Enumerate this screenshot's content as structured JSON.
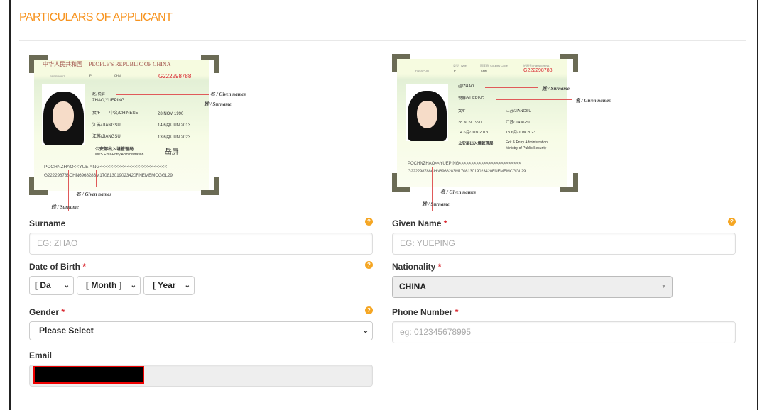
{
  "section_title": "PARTICULARS OF APPLICANT",
  "passport_old": {
    "country_cn": "中华人民共和国",
    "country_en": "PEOPLE'S REPUBLIC OF CHINA",
    "passport_label": "PASSPORT",
    "type": "P",
    "country_code": "CHN",
    "passport_no": "G222298788",
    "name_cn": "赵, 悦屏",
    "name_en": "ZHAO,YUEPING",
    "sex": "女/F",
    "nationality": "中文/CHINESE",
    "dob": "28 NOV 1990",
    "place_birth": "江苏/JIANGSU",
    "issue": "14 6月/JUN 2013",
    "place_issue": "江苏/JIANGSU",
    "expiry": "13 6月/JUN 2023",
    "authority_cn": "公安部出入境管理局",
    "authority_en": "MPS Exit&Entry Administration",
    "signature": "岳屏",
    "mrz1": "POCHNZHAO<<YUEPING<<<<<<<<<<<<<<<<<<<<<<<<<",
    "mrz2": "G222298788CHN6968283M170813019023420FNEMEMCGGL29",
    "ann_given": "名 / Given names",
    "ann_surname": "姓 / Surname",
    "ann_given_bottom": "名 / Given names",
    "ann_surname_bottom": "姓 / Surname"
  },
  "passport_new": {
    "passport_label": "PASSPORT",
    "type_label": "类型/ Type",
    "code_label": "国家码/ Country Code",
    "no_label": "护照号/ Passport No.",
    "type": "P",
    "country_code": "CHN",
    "passport_no": "G222298788",
    "surname": "赵/ZHAO",
    "given": "悦屏/YUEPING",
    "sex": "女/F",
    "place_birth": "江苏/JIANGSU",
    "dob": "28 NOV 1990",
    "place_issue": "江苏/JIANGSU",
    "issue": "14 6月/JUN 2013",
    "expiry": "13 6月/JUN 2023",
    "authority_cn": "公安部出入境管理局",
    "authority_en1": "Exit & Entry Administration",
    "authority_en2": "Ministry of Public Security",
    "mrz1": "POCHNZHAO<<YUEPING<<<<<<<<<<<<<<<<<<<<<<<<<",
    "mrz2": "G222298788CHN6968283M170813019023420FNEMEMCGGL29",
    "ann_surname": "姓 / Surname",
    "ann_given": "名 / Given names",
    "ann_given_bottom": "名 / Given names",
    "ann_surname_bottom": "姓 / Surname"
  },
  "form": {
    "surname": {
      "label": "Surname",
      "placeholder": "EG: ZHAO"
    },
    "given_name": {
      "label": "Given Name",
      "required": "*",
      "placeholder": "EG: YUEPING"
    },
    "dob": {
      "label": "Date of Birth",
      "required": "*",
      "day": "[ Da",
      "month": "[ Month ]",
      "year": "[ Year"
    },
    "nationality": {
      "label": "Nationality",
      "required": "*",
      "value": "CHINA"
    },
    "gender": {
      "label": "Gender",
      "required": "*",
      "value": "Please Select"
    },
    "phone": {
      "label": "Phone Number",
      "required": "*",
      "placeholder": "eg: 012345678995"
    },
    "email": {
      "label": "Email"
    },
    "help_glyph": "?"
  },
  "colors": {
    "accent": "#f7931e",
    "required": "#d9262e",
    "help": "#f5a623",
    "redaction": "#000000"
  }
}
